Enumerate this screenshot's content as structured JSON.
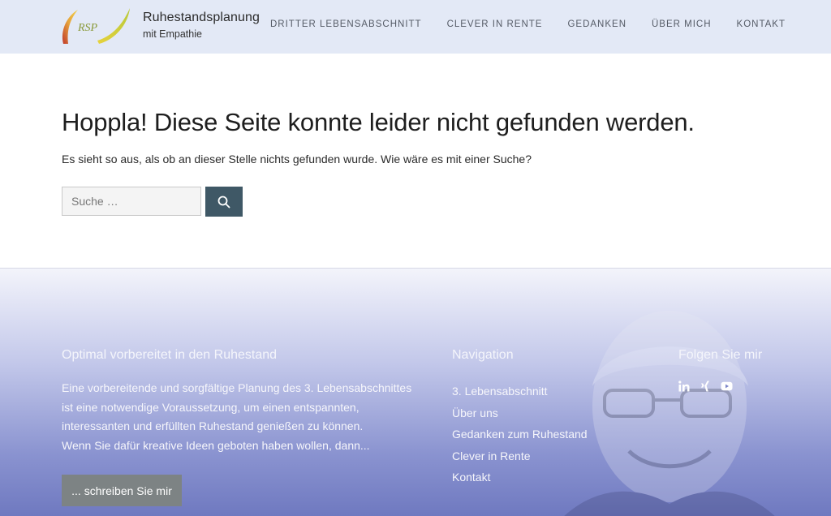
{
  "header": {
    "brand_title": "Ruhestandsplanung",
    "brand_subtitle": "mit Empathie",
    "logo_text": "RSP",
    "nav": [
      {
        "label": "DRITTER LEBENSABSCHNITT"
      },
      {
        "label": "CLEVER IN RENTE"
      },
      {
        "label": "GEDANKEN"
      },
      {
        "label": "ÜBER MICH"
      },
      {
        "label": "KONTAKT"
      }
    ]
  },
  "main": {
    "title": "Hoppla! Diese Seite konnte leider nicht gefunden werden.",
    "text": "Es sieht so aus, als ob an dieser Stelle nichts gefunden wurde. Wie wäre es mit einer Suche?",
    "search": {
      "placeholder": "Suche …",
      "value": "",
      "button_icon": "search-icon"
    }
  },
  "footer": {
    "col1": {
      "heading": "Optimal vorbereitet in den Ruhestand",
      "lines": [
        "Eine vorbereitende und sorgfältige Planung des 3. Lebensabschnittes",
        "ist eine notwendige Voraussetzung, um einen entspannten,",
        "interessanten und erfüllten Ruhestand genießen zu können.",
        "Wenn Sie dafür kreative Ideen geboten haben wollen, dann..."
      ],
      "cta_label": "... schreiben Sie mir"
    },
    "col2": {
      "heading": "Navigation",
      "links": [
        {
          "label": "3. Lebensabschnitt"
        },
        {
          "label": "Über uns"
        },
        {
          "label": "Gedanken zum Ruhestand"
        },
        {
          "label": "Clever in Rente"
        },
        {
          "label": "Kontakt"
        }
      ]
    },
    "col3": {
      "heading": "Folgen Sie mir",
      "icons": [
        "linkedin-icon",
        "xing-icon",
        "youtube-icon"
      ]
    }
  },
  "colors": {
    "header_bg": "#e3e9f6",
    "search_button": "#3f5866",
    "cta_button": "#7d8384",
    "footer_bottom": "#6f79c0"
  }
}
